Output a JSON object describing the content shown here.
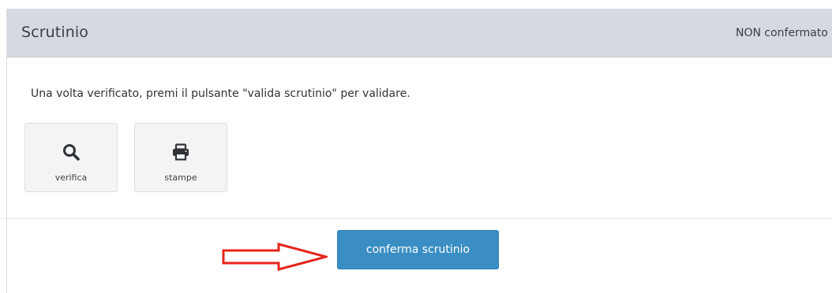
{
  "panel": {
    "title": "Scrutinio",
    "status": "NON confermato"
  },
  "main": {
    "instruction": "Una volta verificato, premi il pulsante \"valida scrutinio\" per validare.",
    "tools": [
      {
        "label": "verifica",
        "icon": "search-icon"
      },
      {
        "label": "stampe",
        "icon": "print-icon"
      }
    ]
  },
  "footer": {
    "confirm_label": "conferma scrutinio",
    "annotation_icon": "red-arrow-right-icon"
  },
  "colors": {
    "header_bg": "#d6d9df",
    "primary_button": "#3a8ec3",
    "annotation_arrow": "#e8241c"
  }
}
